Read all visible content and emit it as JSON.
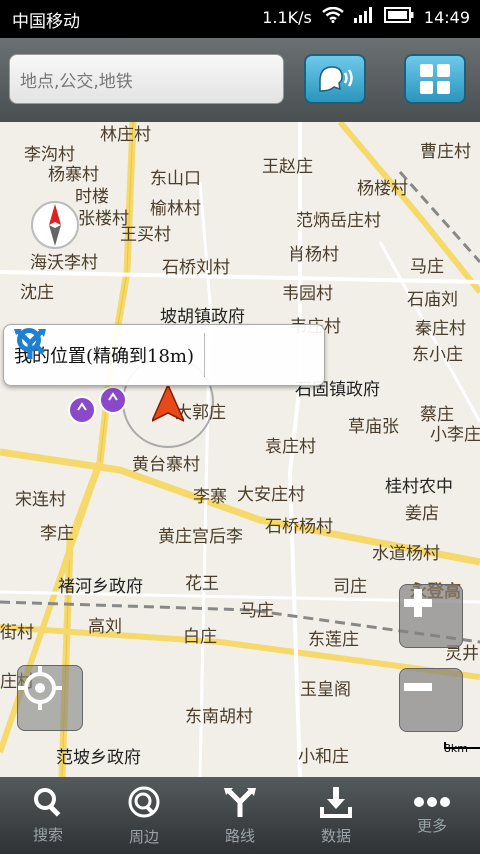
{
  "status": {
    "carrier": "中国移动",
    "speed": "1.1K/s",
    "time": "14:49"
  },
  "search": {
    "placeholder": "地点,公交,地铁"
  },
  "popup": {
    "text": "我的位置(精确到18m)"
  },
  "map_labels": [
    "林庄村",
    "李沟村",
    "杨寨村",
    "时楼",
    "东山口",
    "王赵庄",
    "杨楼村",
    "曹庄村",
    "张楼村",
    "榆林村",
    "王买村",
    "范炳岳庄村",
    "海沃李村",
    "肖杨村",
    "马庄",
    "沈庄",
    "石桥刘村",
    "韦园村",
    "石庙刘",
    "坡胡镇政府",
    "韦庄村",
    "秦庄村",
    "东小庄",
    "石固镇政府",
    "大郭庄",
    "蔡庄",
    "草庙张",
    "小李庄",
    "袁庄村",
    "黄台寨村",
    "宋连村",
    "李寨",
    "大安庄村",
    "桂村农中",
    "李庄",
    "姜店",
    "黄庄宫后李",
    "石桥杨村",
    "水道杨村",
    "褚河乡政府",
    "花王",
    "司庄",
    "永登高",
    "马庄",
    "高刘",
    "白庄",
    "东莲庄",
    "街村",
    "灵井",
    "庄村",
    "玉皇阁",
    "东南胡村",
    "小和庄",
    "范坡乡政府"
  ],
  "scale_label": "8km",
  "bottom_nav": [
    {
      "label": "搜索",
      "icon": "search-icon"
    },
    {
      "label": "周边",
      "icon": "nearby-icon"
    },
    {
      "label": "路线",
      "icon": "route-icon"
    },
    {
      "label": "数据",
      "icon": "download-icon"
    },
    {
      "label": "更多",
      "icon": "more-icon"
    }
  ]
}
